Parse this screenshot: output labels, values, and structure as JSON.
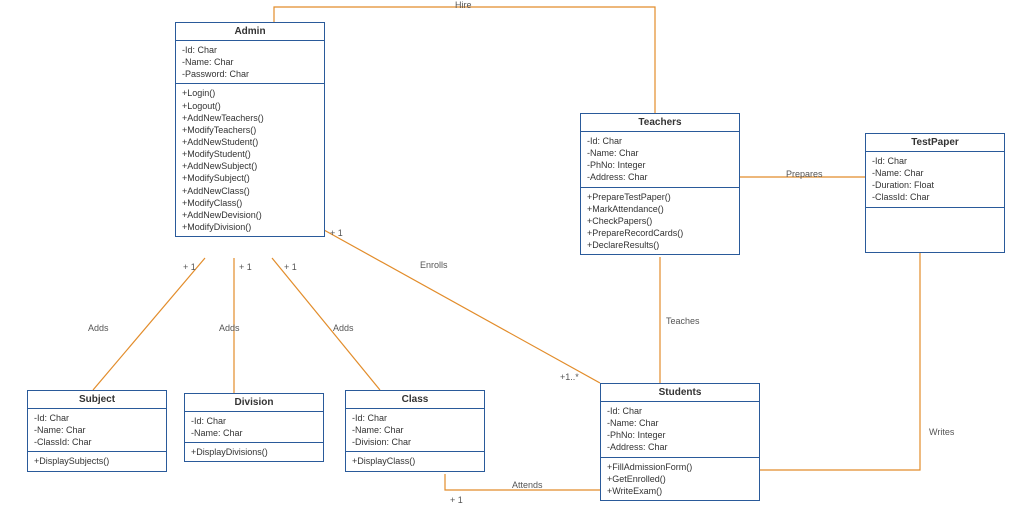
{
  "chart_data": {
    "type": "uml-class-diagram",
    "classes": [
      {
        "id": "admin",
        "name": "Admin",
        "attributes": [
          "-Id: Char",
          "-Name: Char",
          "-Password: Char"
        ],
        "methods": [
          "+Login()",
          "+Logout()",
          "+AddNewTeachers()",
          "+ModifyTeachers()",
          "+AddNewStudent()",
          "+ModifyStudent()",
          "+AddNewSubject()",
          "+ModifySubject()",
          "+AddNewClass()",
          "+ModifyClass()",
          "+AddNewDevision()",
          "+ModifyDivision()"
        ]
      },
      {
        "id": "teachers",
        "name": "Teachers",
        "attributes": [
          "-Id: Char",
          "-Name: Char",
          "-PhNo: Integer",
          "-Address: Char"
        ],
        "methods": [
          "+PrepareTestPaper()",
          "+MarkAttendance()",
          "+CheckPapers()",
          "+PrepareRecordCards()",
          "+DeclareResults()"
        ]
      },
      {
        "id": "testpaper",
        "name": "TestPaper",
        "attributes": [
          "-Id: Char",
          "-Name: Char",
          "-Duration: Float",
          "-ClassId: Char"
        ],
        "methods": []
      },
      {
        "id": "subject",
        "name": "Subject",
        "attributes": [
          "-Id: Char",
          "-Name: Char",
          "-ClassId: Char"
        ],
        "methods": [
          "+DisplaySubjects()"
        ]
      },
      {
        "id": "division",
        "name": "Division",
        "attributes": [
          "-Id: Char",
          "-Name: Char"
        ],
        "methods": [
          "+DisplayDivisions()"
        ]
      },
      {
        "id": "class",
        "name": "Class",
        "attributes": [
          "-Id: Char",
          "-Name: Char",
          "-Division: Char"
        ],
        "methods": [
          "+DisplayClass()"
        ]
      },
      {
        "id": "students",
        "name": "Students",
        "attributes": [
          "-Id: Char",
          "-Name: Char",
          "-PhNo: Integer",
          "-Address: Char"
        ],
        "methods": [
          "+FillAdmissionForm()",
          "+GetEnrolled()",
          "+WriteExam()"
        ]
      }
    ],
    "relationships": [
      {
        "from": "Admin",
        "to": "Teachers",
        "label": "Hire",
        "from_mult": "",
        "to_mult": ""
      },
      {
        "from": "Admin",
        "to": "Subject",
        "label": "Adds",
        "from_mult": "+ 1",
        "to_mult": ""
      },
      {
        "from": "Admin",
        "to": "Division",
        "label": "Adds",
        "from_mult": "+ 1",
        "to_mult": ""
      },
      {
        "from": "Admin",
        "to": "Class",
        "label": "Adds",
        "from_mult": "+ 1",
        "to_mult": ""
      },
      {
        "from": "Admin",
        "to": "Students",
        "label": "Enrolls",
        "from_mult": "+ 1",
        "to_mult": "+1..*"
      },
      {
        "from": "Teachers",
        "to": "TestPaper",
        "label": "Prepares",
        "from_mult": "",
        "to_mult": ""
      },
      {
        "from": "Teachers",
        "to": "Students",
        "label": "Teaches",
        "from_mult": "",
        "to_mult": ""
      },
      {
        "from": "Students",
        "to": "Class",
        "label": "Attends",
        "from_mult": "",
        "to_mult": "+ 1"
      },
      {
        "from": "Students",
        "to": "TestPaper",
        "label": "Writes",
        "from_mult": "",
        "to_mult": ""
      }
    ]
  },
  "labels": {
    "hire": "Hire",
    "adds": "Adds",
    "enrolls": "Enrolls",
    "prepares": "Prepares",
    "teaches": "Teaches",
    "attends": "Attends",
    "writes": "Writes",
    "plus1": "+ 1",
    "plus1star": "+1..*"
  }
}
